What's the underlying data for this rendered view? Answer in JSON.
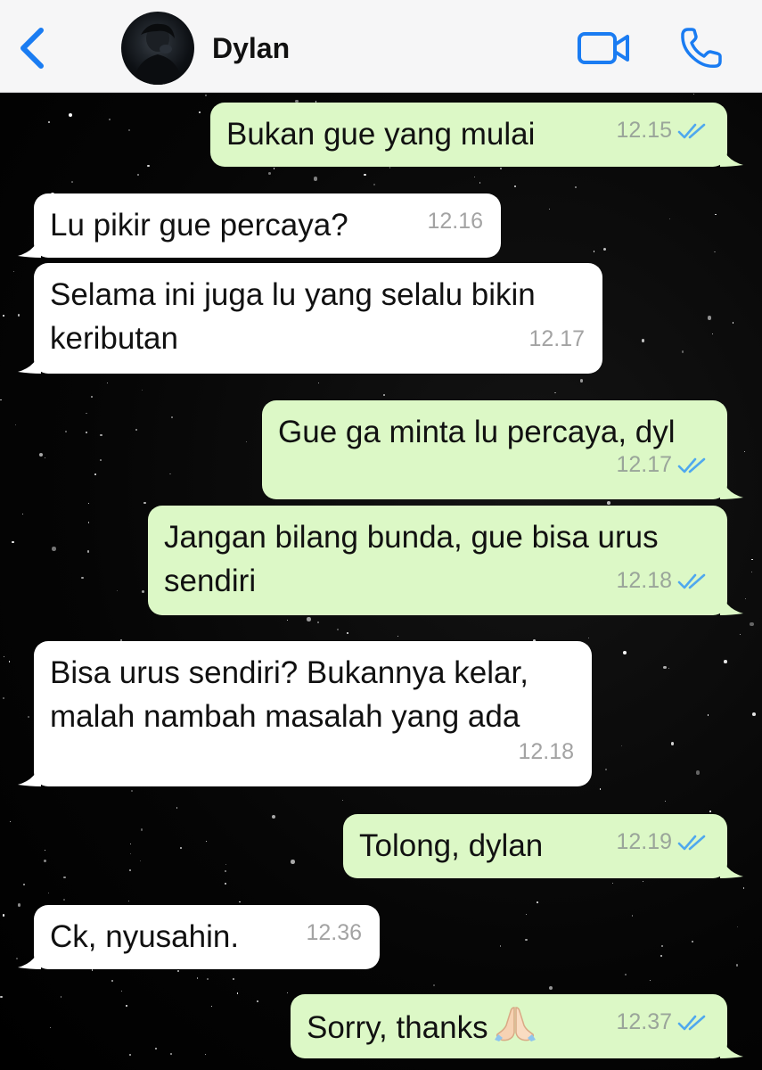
{
  "header": {
    "contact_name": "Dylan"
  },
  "colors": {
    "outgoing_bubble": "#dcf8c6",
    "incoming_bubble": "#ffffff",
    "accent_blue": "#1a7cf2",
    "read_ticks": "#4fa8ee"
  },
  "messages": [
    {
      "direction": "out",
      "lines": [
        "Bukan gue yang mulai"
      ],
      "time": "12.15",
      "status": "read"
    },
    {
      "direction": "in",
      "lines": [
        "Lu pikir gue percaya?"
      ],
      "time": "12.16"
    },
    {
      "direction": "in",
      "lines": [
        "Selama ini juga lu yang selalu bikin",
        "keributan"
      ],
      "time": "12.17"
    },
    {
      "direction": "out",
      "lines": [
        "Gue ga minta lu percaya, dyl"
      ],
      "time": "12.17",
      "status": "read"
    },
    {
      "direction": "out",
      "lines": [
        "Jangan bilang bunda, gue bisa urus",
        "sendiri"
      ],
      "time": "12.18",
      "status": "read"
    },
    {
      "direction": "in",
      "lines": [
        "Bisa urus sendiri? Bukannya kelar,",
        "malah nambah masalah yang ada"
      ],
      "time": "12.18"
    },
    {
      "direction": "out",
      "lines": [
        "Tolong, dylan"
      ],
      "time": "12.19",
      "status": "read"
    },
    {
      "direction": "in",
      "lines": [
        "Ck, nyusahin."
      ],
      "time": "12.36"
    },
    {
      "direction": "out",
      "lines": [
        "Sorry, thanks"
      ],
      "time": "12.37",
      "status": "read",
      "emoji": "folded-hands"
    }
  ]
}
